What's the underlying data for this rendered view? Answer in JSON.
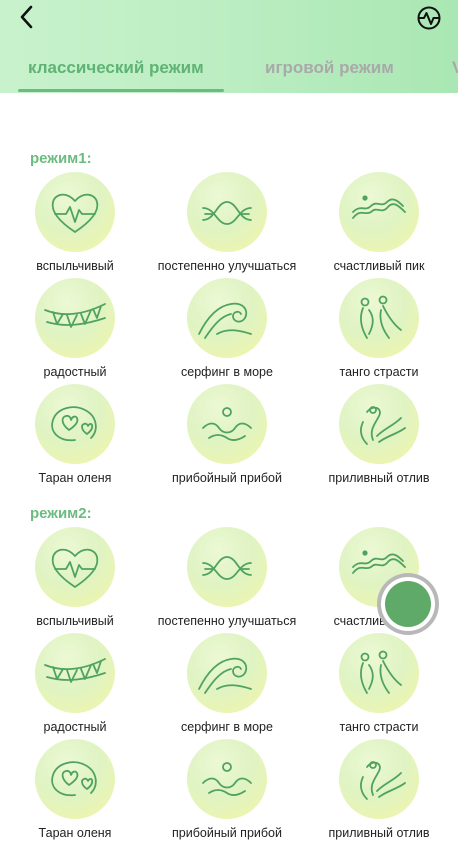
{
  "header": {
    "back_icon": "chevron-left-icon",
    "activity_icon": "activity-pulse-icon"
  },
  "tabs": [
    {
      "label": "классический режим",
      "active": true
    },
    {
      "label": "игровой режим",
      "active": false
    },
    {
      "label": "V",
      "active": false
    }
  ],
  "sections": [
    {
      "title": "режим1:",
      "items": [
        {
          "label": "вспыльчивый",
          "icon": "heart-pulse-icon"
        },
        {
          "label": "постепенно улучшаться",
          "icon": "crossing-waves-icon"
        },
        {
          "label": "счастливый пик",
          "icon": "surfer-wave-icon"
        },
        {
          "label": "радостный",
          "icon": "bunting-flags-icon"
        },
        {
          "label": "серфинг в море",
          "icon": "ocean-wave-icon"
        },
        {
          "label": "танго страсти",
          "icon": "tango-dancers-icon"
        },
        {
          "label": "Таран оленя",
          "icon": "hearts-swirl-icon"
        },
        {
          "label": "прибойный прибой",
          "icon": "swimmer-waves-icon"
        },
        {
          "label": "приливный отлив",
          "icon": "tide-figure-icon"
        }
      ]
    },
    {
      "title": "режим2:",
      "items": [
        {
          "label": "вспыльчивый",
          "icon": "heart-pulse-icon"
        },
        {
          "label": "постепенно улучшаться",
          "icon": "crossing-waves-icon"
        },
        {
          "label": "счастливый пик",
          "icon": "surfer-wave-icon"
        },
        {
          "label": "радостный",
          "icon": "bunting-flags-icon"
        },
        {
          "label": "серфинг в море",
          "icon": "ocean-wave-icon"
        },
        {
          "label": "танго страсти",
          "icon": "tango-dancers-icon"
        },
        {
          "label": "Таран оленя",
          "icon": "hearts-swirl-icon"
        },
        {
          "label": "прибойный прибой",
          "icon": "swimmer-waves-icon"
        },
        {
          "label": "приливный отлив",
          "icon": "tide-figure-icon"
        }
      ]
    }
  ],
  "floating_button": {
    "icon": "record-dot-icon",
    "color": "#5faa68"
  },
  "colors": {
    "accent": "#6cbc7f",
    "inactive_tab": "#a9a9a9",
    "header_bg": "#c8f2cc"
  }
}
